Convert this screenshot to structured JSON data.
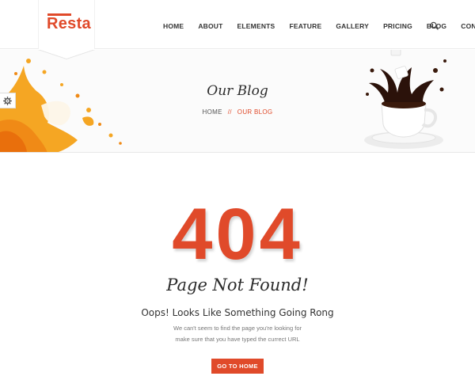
{
  "header": {
    "logo_text": "Resta",
    "nav": [
      "HOME",
      "ABOUT",
      "ELEMENTS",
      "FEATURE",
      "GALLERY",
      "PRICING",
      "BLOG",
      "CONTACT"
    ]
  },
  "banner": {
    "title": "Our Blog",
    "breadcrumb": {
      "home": "HOME",
      "separator": "//",
      "current": "OUR BLOG"
    }
  },
  "error": {
    "code": "404",
    "heading": "Page Not Found!",
    "subheading": "Oops! Looks Like Something Going Rong",
    "description_line1": "We can't seem to find the page you're looking for",
    "description_line2": "make sure that you have typed the currect URL",
    "button_label": "GO TO HOME"
  },
  "colors": {
    "accent": "#e04a2a",
    "text": "#333333",
    "muted": "#777777"
  },
  "icons": {
    "search": "search-icon",
    "settings": "gear-icon"
  }
}
